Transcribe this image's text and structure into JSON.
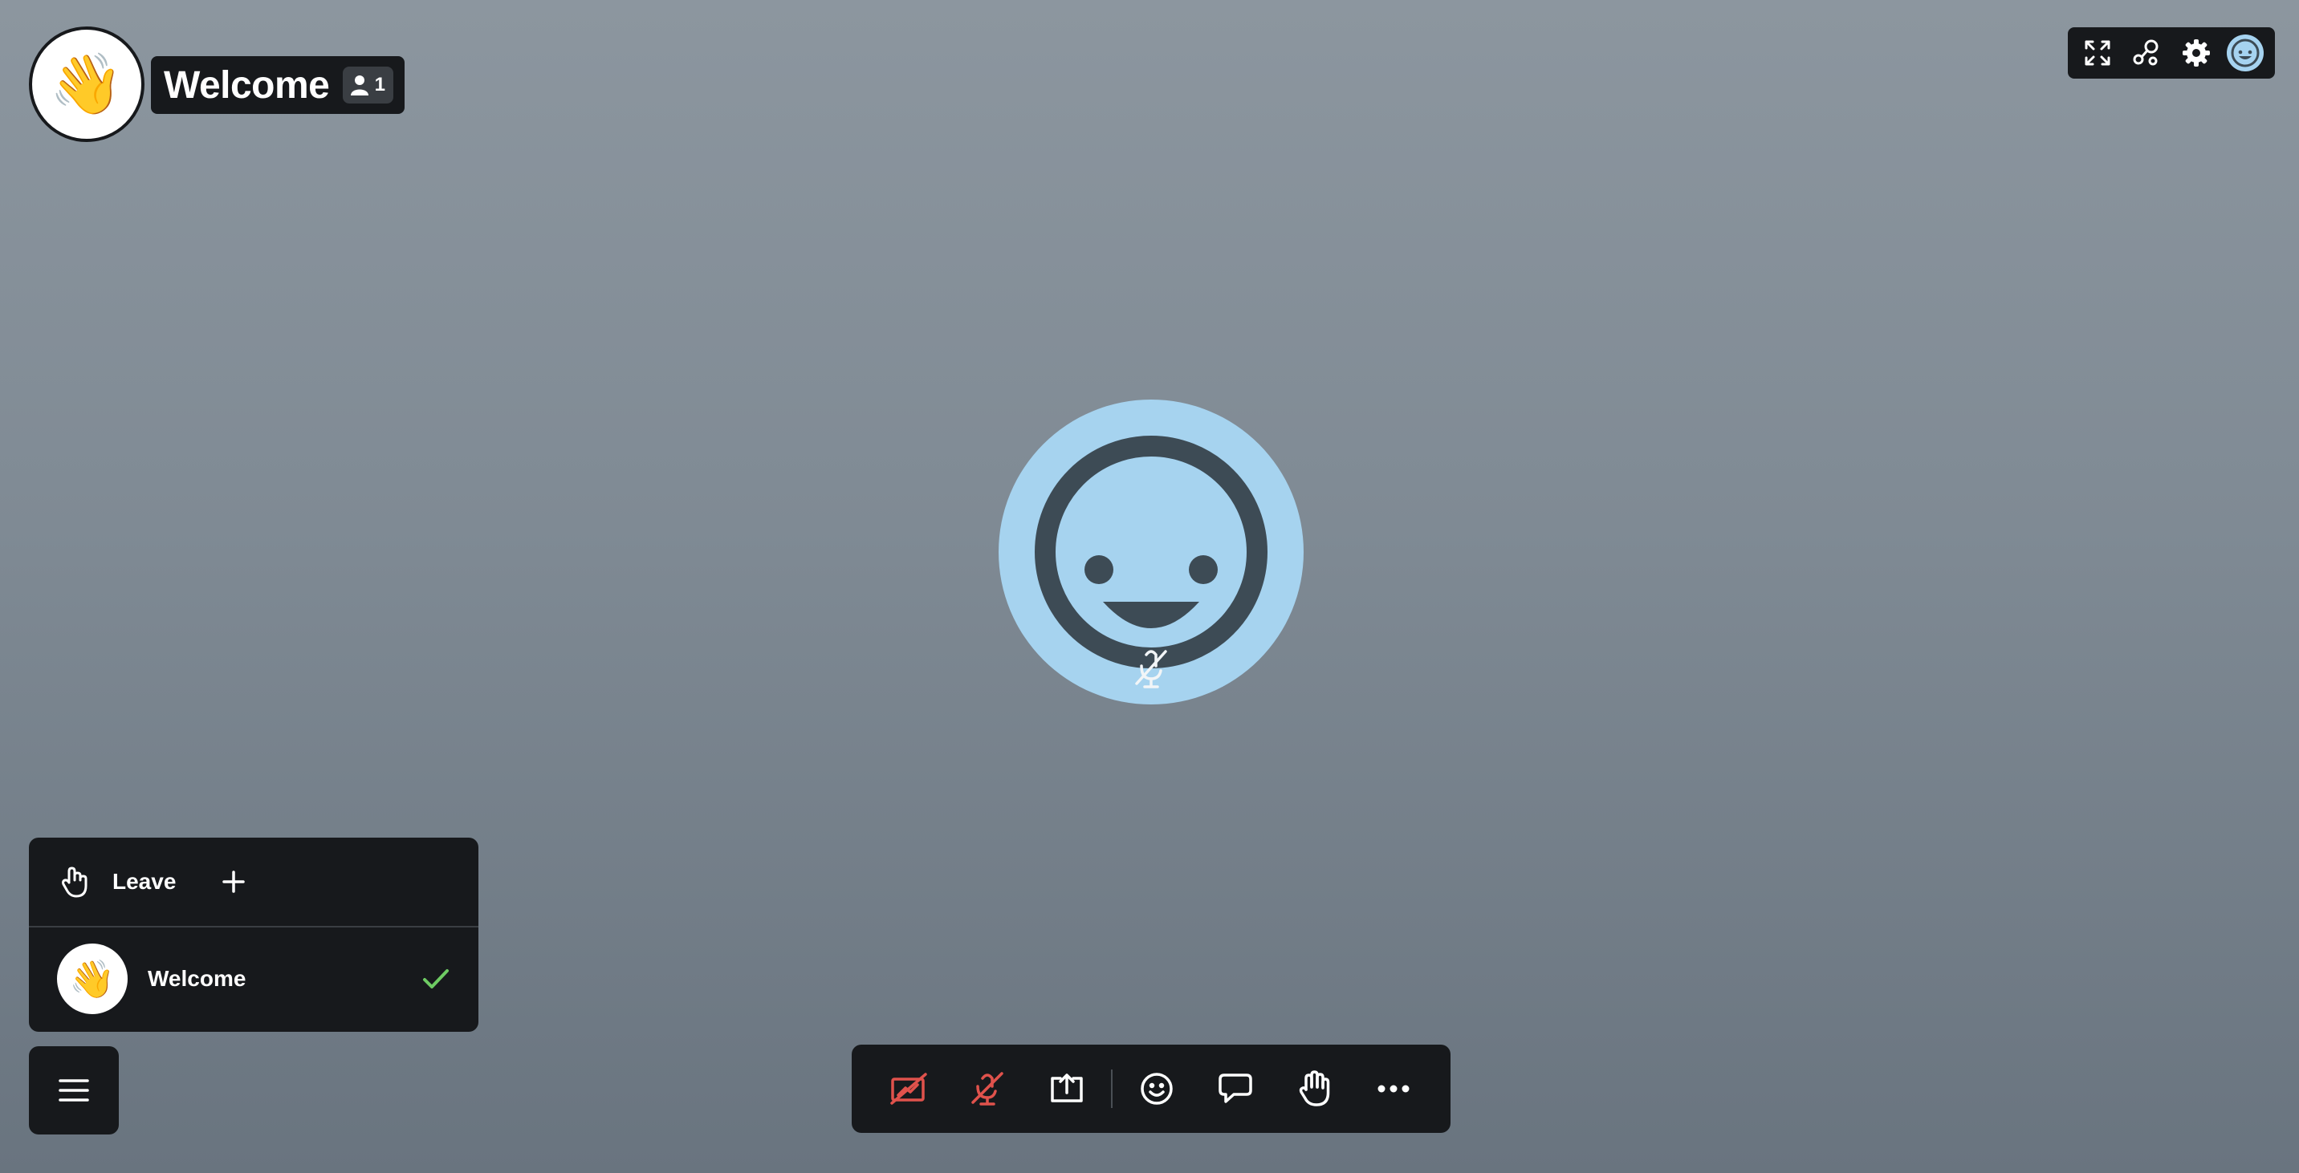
{
  "room": {
    "emoji": "👋",
    "title": "Welcome",
    "participant_count": "1"
  },
  "top_toolbar": {
    "icons": [
      "fullscreen-icon",
      "connection-graph-icon",
      "gear-icon",
      "user-avatar-icon"
    ]
  },
  "participant": {
    "avatar_icon": "smiley-face-icon",
    "status_icon": "microphone-muted-icon",
    "avatar_color": "#a6d3ef"
  },
  "room_list": {
    "leave_label": "Leave",
    "rooms": [
      {
        "emoji": "👋",
        "name": "Welcome",
        "selected": true
      }
    ]
  },
  "controls": {
    "icons": [
      "camera-off-icon",
      "microphone-off-icon",
      "share-screen-icon",
      "emoji-icon",
      "chat-icon",
      "raise-hand-icon",
      "more-icon"
    ],
    "danger_color": "#e0524c"
  },
  "colors": {
    "panel": "#17191c",
    "check": "#6ecb63",
    "background_top": "#8c969f",
    "background_bottom": "#69747f"
  }
}
